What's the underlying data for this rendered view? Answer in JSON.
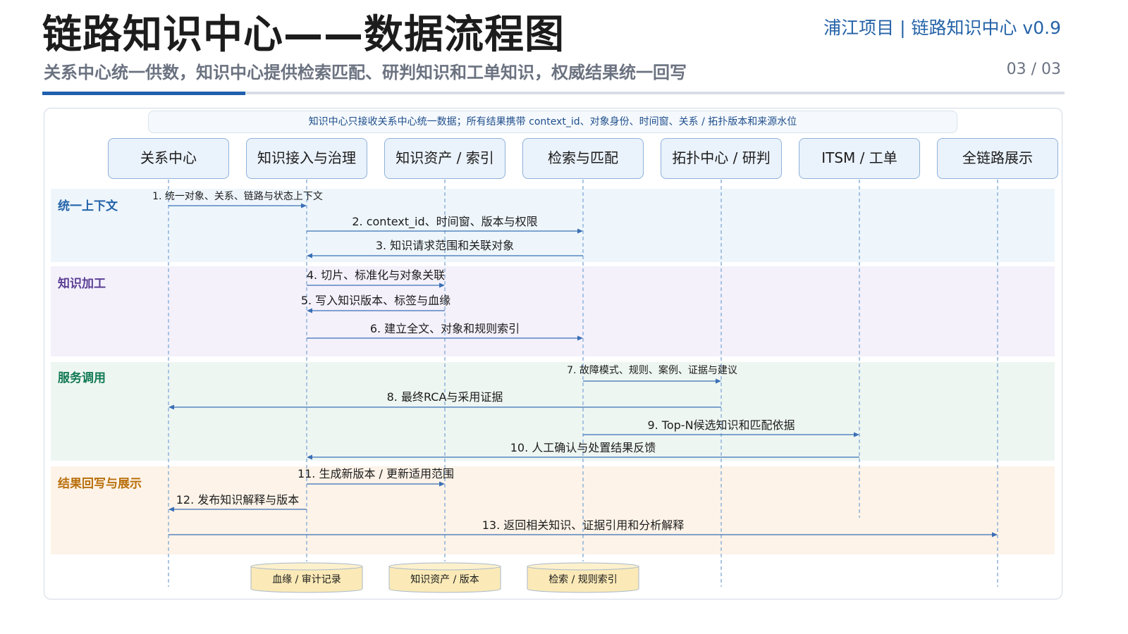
{
  "header": {
    "title": "链路知识中心——数据流程图",
    "brand": "浦江项目 | 链路知识中心 v0.9",
    "subtitle": "关系中心统一供数，知识中心提供检索匹配、研判知识和工单知识，权威结果统一回写",
    "page": "03 / 03"
  },
  "note": "知识中心只接收关系中心统一数据；所有结果携带 context_id、对象身份、时间窗、关系 / 拓扑版本和来源水位",
  "participants": [
    "关系中心",
    "知识接入与治理",
    "知识资产 / 索引",
    "检索与匹配",
    "拓扑中心 / 研判",
    "ITSM / 工单",
    "全链路展示"
  ],
  "bands": [
    "统一上下文",
    "知识加工",
    "服务调用",
    "结果回写与展示"
  ],
  "colors": {
    "accent": "#1f5fae",
    "lifeline": "#8fb2d9",
    "arrow": "#3a6fb5",
    "store_fill": "#fbeab7",
    "store_stroke": "#a8b8c8"
  },
  "messages": [
    {
      "from": 0,
      "to": 1,
      "text": "1. 统一对象、关系、链路与状态上下文"
    },
    {
      "from": 1,
      "to": 3,
      "text": "2. context_id、时间窗、版本与权限"
    },
    {
      "from": 3,
      "to": 1,
      "text": "3. 知识请求范围和关联对象"
    },
    {
      "from": 1,
      "to": 2,
      "text": "4. 切片、标准化与对象关联"
    },
    {
      "from": 2,
      "to": 1,
      "text": "5. 写入知识版本、标签与血缘"
    },
    {
      "from": 1,
      "to": 3,
      "text": "6. 建立全文、对象和规则索引"
    },
    {
      "from": 3,
      "to": 4,
      "text": "7. 故障模式、规则、案例、证据与建议"
    },
    {
      "from": 4,
      "to": 0,
      "text": "8. 最终RCA与采用证据"
    },
    {
      "from": 3,
      "to": 5,
      "text": "9. Top-N候选知识和匹配依据"
    },
    {
      "from": 5,
      "to": 1,
      "text": "10. 人工确认与处置结果反馈"
    },
    {
      "from": 1,
      "to": 2,
      "text": "11. 生成新版本 / 更新适用范围"
    },
    {
      "from": 1,
      "to": 0,
      "text": "12. 发布知识解释与版本"
    },
    {
      "from": 0,
      "to": 6,
      "text": "13. 返回相关知识、证据引用和分析解释"
    }
  ],
  "stores": [
    "血缘 / 审计记录",
    "知识资产 / 版本",
    "检索 / 规则索引"
  ]
}
